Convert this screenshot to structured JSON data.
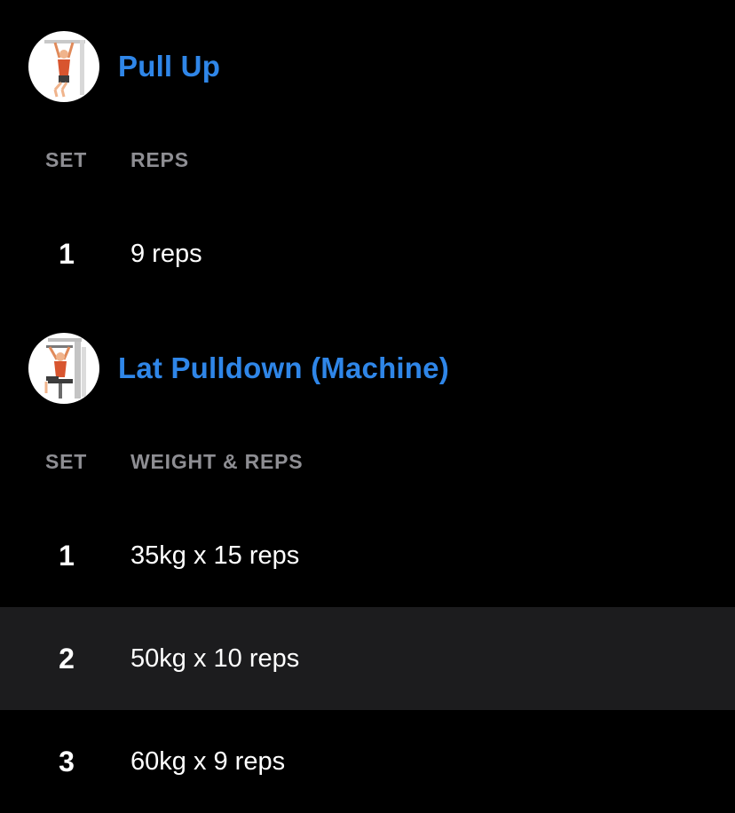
{
  "exercises": [
    {
      "name": "Pull Up",
      "icon": "pull-up-icon",
      "columns": {
        "set": "SET",
        "value": "REPS"
      },
      "sets": [
        {
          "set": "1",
          "value": "9 reps",
          "highlighted": false
        }
      ]
    },
    {
      "name": "Lat Pulldown (Machine)",
      "icon": "lat-pulldown-icon",
      "columns": {
        "set": "SET",
        "value": "WEIGHT & REPS"
      },
      "sets": [
        {
          "set": "1",
          "value": "35kg x 15 reps",
          "highlighted": false
        },
        {
          "set": "2",
          "value": "50kg x 10 reps",
          "highlighted": true
        },
        {
          "set": "3",
          "value": "60kg x 9 reps",
          "highlighted": false
        }
      ]
    }
  ],
  "colors": {
    "background": "#000000",
    "accent": "#2f86e8",
    "header_text": "#8e8e93",
    "highlight_row": "#1c1c1e"
  }
}
